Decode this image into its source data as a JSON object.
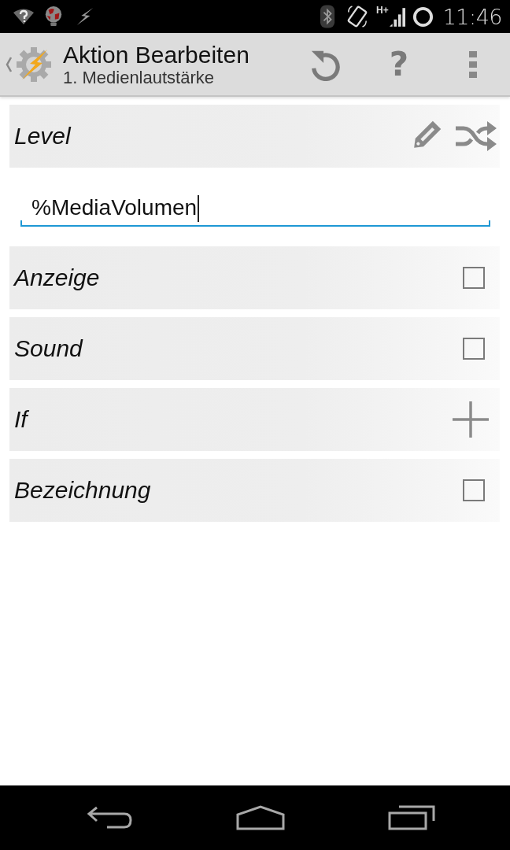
{
  "status_bar": {
    "network_type": "H+",
    "time": "11:46"
  },
  "action_bar": {
    "title": "Aktion Bearbeiten",
    "subtitle": "1. Medienlautstärke",
    "help_button": "?"
  },
  "rows": [
    {
      "kind": "tools",
      "label": "Level"
    },
    {
      "kind": "field",
      "value": "%MediaVolumen",
      "focused": true
    },
    {
      "kind": "checkbox",
      "label": "Anzeige",
      "checked": false
    },
    {
      "kind": "checkbox",
      "label": "Sound",
      "checked": false
    },
    {
      "kind": "add",
      "label": "If"
    },
    {
      "kind": "checkbox",
      "label": "Bezeichnung",
      "checked": false
    }
  ]
}
